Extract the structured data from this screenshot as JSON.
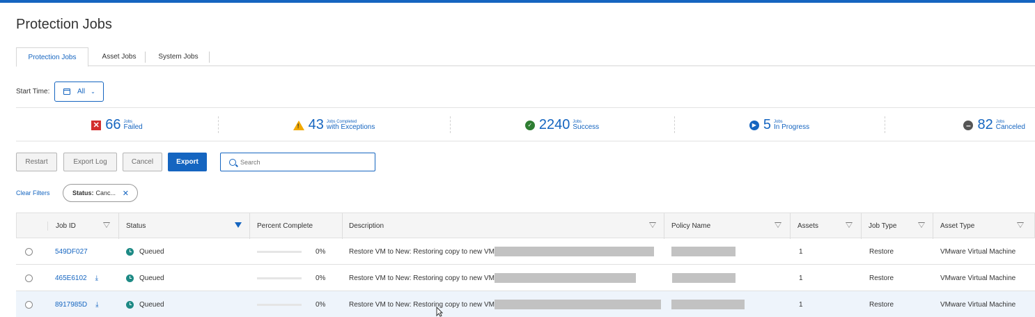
{
  "page": {
    "title": "Protection Jobs"
  },
  "tabs": [
    {
      "label": "Protection Jobs",
      "active": true
    },
    {
      "label": "Asset Jobs",
      "active": false
    },
    {
      "label": "System Jobs",
      "active": false
    }
  ],
  "start_time": {
    "label": "Start Time:",
    "value": "All"
  },
  "summary": [
    {
      "count": "66",
      "small": "Jobs",
      "big": "Failed",
      "icon": "failed-icon",
      "color": "#d32f2f"
    },
    {
      "count": "43",
      "small": "Jobs Completed",
      "big": "with Exceptions",
      "icon": "warning-icon",
      "color": "#f2a900"
    },
    {
      "count": "2240",
      "small": "Jobs",
      "big": "Success",
      "icon": "success-icon",
      "color": "#2e7d32"
    },
    {
      "count": "5",
      "small": "Jobs",
      "big": "In Progress",
      "icon": "in-progress-icon",
      "color": "#1565c0"
    },
    {
      "count": "82",
      "small": "Jobs",
      "big": "Canceled",
      "icon": "canceled-icon",
      "color": "#555555"
    }
  ],
  "toolbar": {
    "restart": "Restart",
    "export_log": "Export Log",
    "cancel": "Cancel",
    "export": "Export",
    "search_placeholder": "Search"
  },
  "filters": {
    "clear_label": "Clear Filters",
    "chip_key": "Status:",
    "chip_value": "Canc..."
  },
  "columns": {
    "job_id": "Job ID",
    "status": "Status",
    "percent": "Percent Complete",
    "description": "Description",
    "policy": "Policy Name",
    "assets": "Assets",
    "job_type": "Job Type",
    "asset_type": "Asset Type"
  },
  "rows": [
    {
      "job_id": "549DF027",
      "status": "Queued",
      "percent": 0,
      "percent_label": "0%",
      "description": "Restore VM to New: Restoring copy to new VM",
      "assets": "1",
      "job_type": "Restore",
      "asset_type": "VMware Virtual Machine",
      "download": false
    },
    {
      "job_id": "465E6102",
      "status": "Queued",
      "percent": 0,
      "percent_label": "0%",
      "description": "Restore VM to New: Restoring copy to new VM",
      "assets": "1",
      "job_type": "Restore",
      "asset_type": "VMware Virtual Machine",
      "download": true
    },
    {
      "job_id": "8917985D",
      "status": "Queued",
      "percent": 0,
      "percent_label": "0%",
      "description": "Restore VM to New: Restoring copy to new VM",
      "assets": "1",
      "job_type": "Restore",
      "asset_type": "VMware Virtual Machine",
      "download": true
    }
  ],
  "colors": {
    "accent": "#1565c0",
    "queued": "#1e8a85"
  }
}
